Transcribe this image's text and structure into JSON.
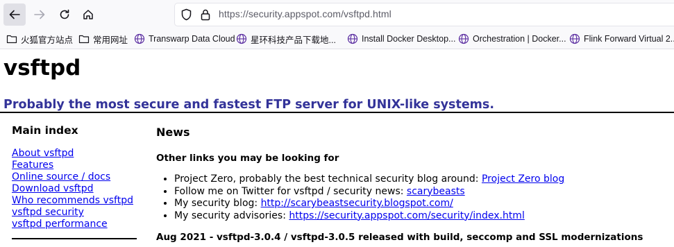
{
  "browser": {
    "url": "https://security.appspot.com/vsftpd.html",
    "bookmarks": [
      {
        "label": "火狐官方站点",
        "icon": "folder-icon"
      },
      {
        "label": "常用网址",
        "icon": "folder-icon"
      },
      {
        "label": "Transwarp Data Cloud",
        "icon": "globe-icon"
      },
      {
        "label": "星环科技产品下载地...",
        "icon": "globe-icon"
      },
      {
        "label": "Install Docker Desktop...",
        "icon": "globe-icon"
      },
      {
        "label": "Orchestration | Docker...",
        "icon": "globe-icon"
      },
      {
        "label": "Flink Forward Virtual 2...",
        "icon": "globe-icon"
      }
    ]
  },
  "page": {
    "title": "vsftpd",
    "tagline": "Probably the most secure and fastest FTP server for UNIX-like systems.",
    "sidebar": {
      "heading": "Main index",
      "links": [
        "About vsftpd",
        "Features",
        "Online source / docs",
        "Download vsftpd",
        "Who recommends vsftpd",
        "vsftpd security",
        "vsftpd performance"
      ]
    },
    "main": {
      "heading": "News",
      "subheading": "Other links you may be looking for",
      "items": [
        {
          "text": "Project Zero, probably the best technical security blog around: ",
          "link": "Project Zero blog"
        },
        {
          "text": "Follow me on Twitter for vsftpd / security news: ",
          "link": "scarybeasts"
        },
        {
          "text": "My security blog: ",
          "link": "http://scarybeastsecurity.blogspot.com/"
        },
        {
          "text": "My security advisories: ",
          "link": "https://security.appspot.com/security/index.html"
        }
      ],
      "news_headline": "Aug 2021 - vsftpd-3.0.4 / vsftpd-3.0.5 released with build, seccomp and SSL modernizations"
    }
  }
}
